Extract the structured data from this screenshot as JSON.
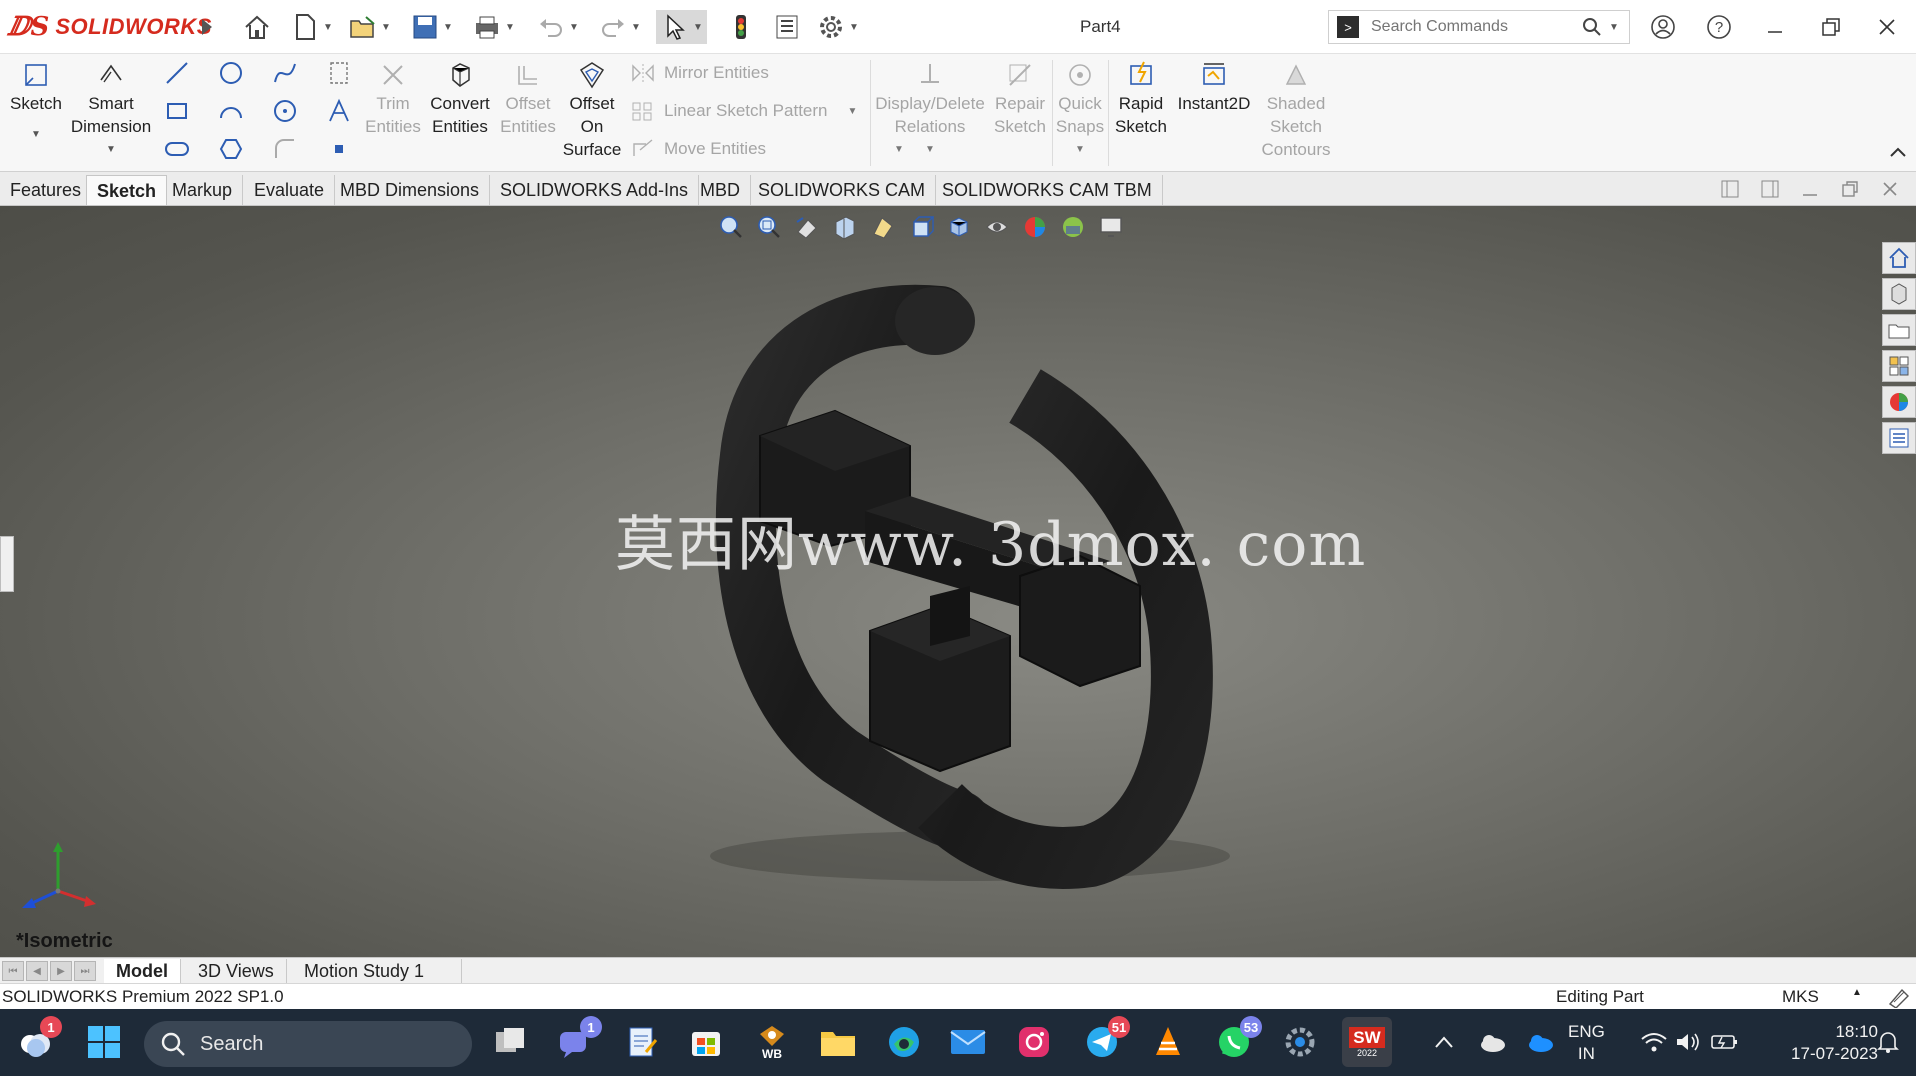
{
  "app": {
    "brand": "SOLIDWORKS",
    "document_title": "Part4",
    "colors": {
      "brand_red": "#d52b1e",
      "viewport": "#6d6d67",
      "taskbar": "#1e2a38"
    }
  },
  "search": {
    "placeholder": "Search Commands"
  },
  "ribbon": {
    "sketch": "Sketch",
    "smart_dimension": "Smart Dimension",
    "trim_entities": "Trim Entities",
    "convert_entities": "Convert Entities",
    "offset_entities": "Offset Entities",
    "offset_on_surface": "Offset On Surface",
    "mirror_entities": "Mirror Entities",
    "linear_sketch_pattern": "Linear Sketch Pattern",
    "move_entities": "Move Entities",
    "display_delete_relations": "Display/Delete Relations",
    "repair_sketch": "Repair Sketch",
    "quick_snaps": "Quick Snaps",
    "rapid_sketch": "Rapid Sketch",
    "instant2d": "Instant2D",
    "shaded_sketch_contours": "Shaded Sketch Contours"
  },
  "tabs": [
    "Features",
    "Sketch",
    "Markup",
    "Evaluate",
    "MBD Dimensions",
    "SOLIDWORKS Add-Ins",
    "MBD",
    "SOLIDWORKS CAM",
    "SOLIDWORKS CAM TBM"
  ],
  "active_tab": "Sketch",
  "viewport": {
    "watermark": "莫西网www. 3dmox. com",
    "view_orientation": "*Isometric"
  },
  "bottom_tabs": [
    "Model",
    "3D Views",
    "Motion Study 1"
  ],
  "status": {
    "product": "SOLIDWORKS Premium 2022 SP1.0",
    "mode": "Editing Part",
    "units": "MKS"
  },
  "taskbar": {
    "search_label": "Search",
    "badges": {
      "weather": "1",
      "teams": "1",
      "telegram": "51",
      "whatsapp": "53"
    },
    "wb_label": "WB",
    "sw_label": "SW",
    "sw_year": "2022",
    "language": "ENG",
    "region": "IN",
    "time": "18:10",
    "date": "17-07-2023"
  }
}
